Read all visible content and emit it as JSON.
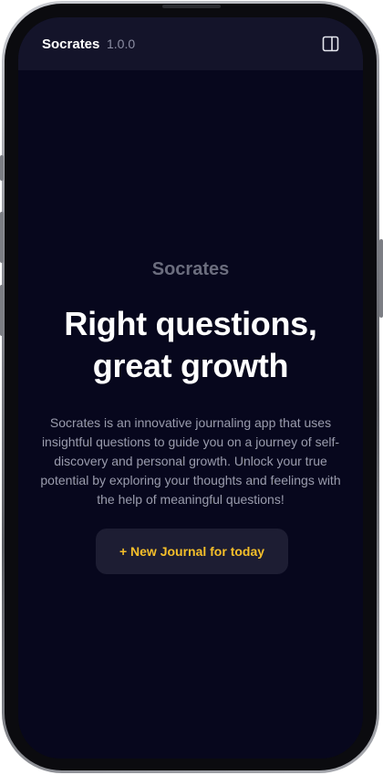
{
  "header": {
    "app_name": "Socrates",
    "version": "1.0.0",
    "toggle_icon": "sidebar-toggle-icon"
  },
  "hero": {
    "brand": "Socrates",
    "headline_line1": "Right questions,",
    "headline_line2": "great growth",
    "description": "Socrates is an innovative journaling app that uses insightful questions to guide you on a journey of self-discovery and personal growth. Unlock your true potential by exploring your thoughts and feelings with the help of meaningful questions!"
  },
  "cta": {
    "label": "+ New Journal for today"
  },
  "colors": {
    "background": "#07071d",
    "topbar": "#14142a",
    "accent": "#f5bf2a",
    "button_bg": "#1d1d33"
  }
}
